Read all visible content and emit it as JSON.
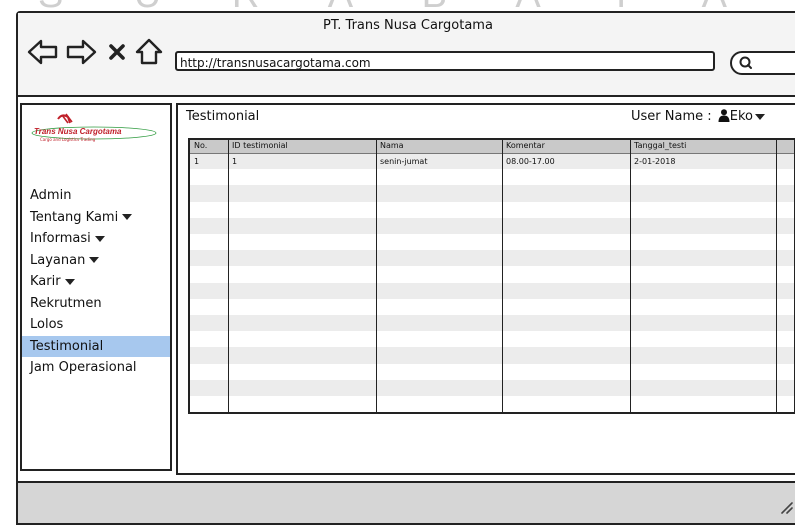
{
  "watermark": "S U R A B A Y A",
  "window": {
    "title": "PT. Trans Nusa Cargotama",
    "url": "http://transnusacargotama.com"
  },
  "logo": {
    "name": "Trans Nusa Cargotama",
    "tagline": "Cargo and Logistics Trading"
  },
  "sidebar": {
    "items": [
      {
        "label": "Admin",
        "dropdown": false
      },
      {
        "label": "Tentang Kami",
        "dropdown": true
      },
      {
        "label": "Informasi",
        "dropdown": true
      },
      {
        "label": "Layanan",
        "dropdown": true
      },
      {
        "label": "Karir",
        "dropdown": true
      },
      {
        "label": "Rekrutmen",
        "dropdown": false
      },
      {
        "label": "Lolos",
        "dropdown": false
      },
      {
        "label": "Testimonial",
        "dropdown": false,
        "active": true
      },
      {
        "label": "Jam Operasional",
        "dropdown": false
      }
    ]
  },
  "main": {
    "title": "Testimonial",
    "user_label": "User Name :",
    "user_name": "Eko"
  },
  "table": {
    "columns": [
      "No.",
      "ID testimonial",
      "Nama",
      "Komentar",
      "Tanggal_testi"
    ],
    "rows": [
      [
        "1",
        "1",
        "senin-jumat",
        "08.00-17.00",
        "2-01-2018"
      ]
    ],
    "empty_rows": 15
  },
  "colors": {
    "active_menu": "#a7c8ee",
    "logo_red": "#c0202a",
    "header_gray": "#c9c9c9",
    "stripe_gray": "#ececec"
  }
}
